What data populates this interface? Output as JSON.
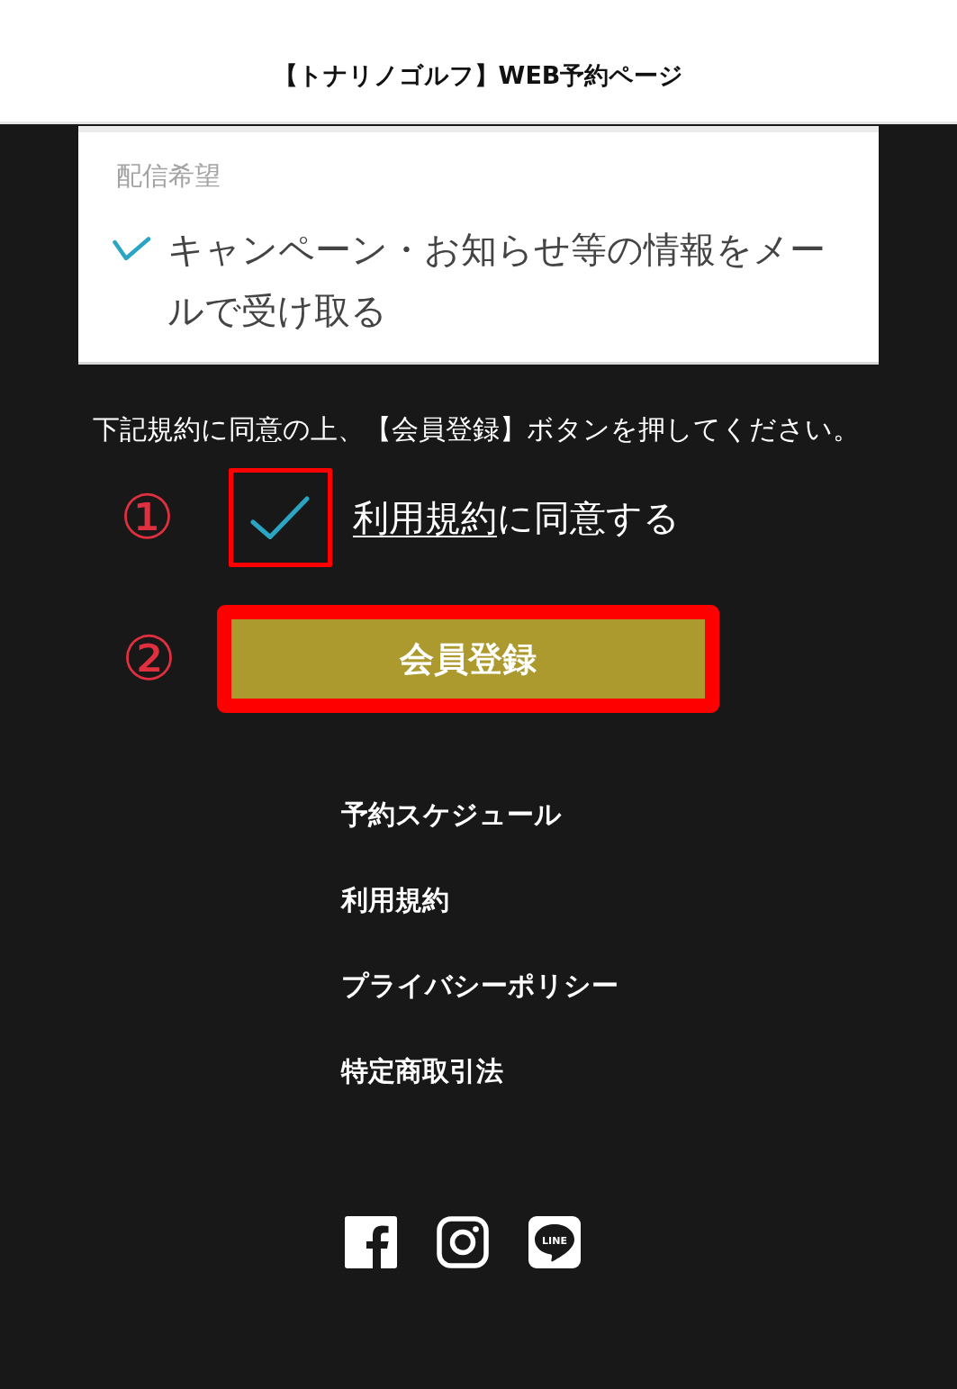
{
  "header": {
    "title": "【トナリノゴルフ】WEB予約ページ"
  },
  "newsletter": {
    "label": "配信希望",
    "option": {
      "text": "キャンペーン・お知らせ等の情報をメールで受け取る",
      "checked": true
    }
  },
  "instructions": "下記規約に同意の上、【会員登録】ボタンを押してください。",
  "agreement": {
    "marker": "①",
    "highlighted": true,
    "checked": true,
    "link": "利用規約",
    "text": "に同意する"
  },
  "register": {
    "marker": "②",
    "highlighted": true,
    "label": "会員登録"
  },
  "footer_links": [
    "予約スケジュール",
    "利用規約",
    "プライバシーポリシー",
    "特定商取引法"
  ],
  "social": [
    {
      "kind": "facebook"
    },
    {
      "kind": "instagram"
    },
    {
      "kind": "line",
      "label": "LINE"
    }
  ]
}
